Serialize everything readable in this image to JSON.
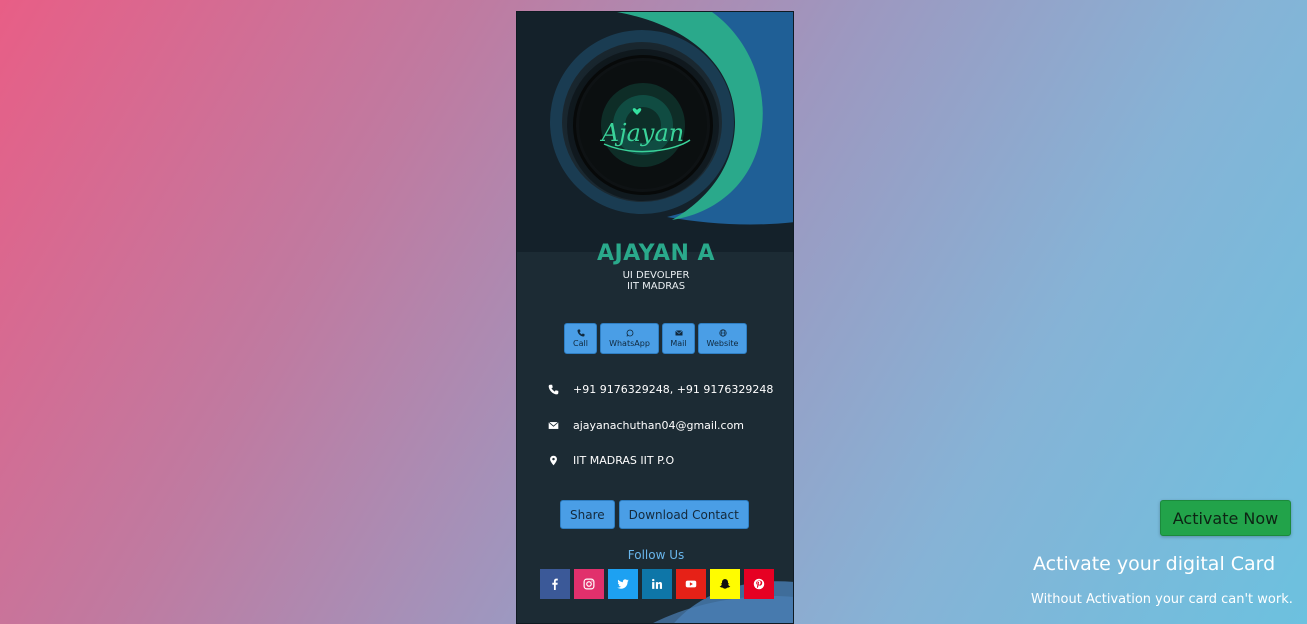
{
  "colors": {
    "accent_green": "#2aa98b",
    "button_blue": "#4a9ee6",
    "activate_green": "#22a34a",
    "follow_blue": "#69b6ec"
  },
  "profile": {
    "logo_text": "Ajayan",
    "name": "AJAYAN A",
    "role": "UI DEVOLPER",
    "org": "IIT MADRAS"
  },
  "quick_actions": [
    {
      "label": "Call",
      "icon": "phone-icon"
    },
    {
      "label": "WhatsApp",
      "icon": "whatsapp-icon"
    },
    {
      "label": "Mail",
      "icon": "envelope-icon"
    },
    {
      "label": "Website",
      "icon": "globe-icon"
    }
  ],
  "contact": {
    "phone": "+91 9176329248, +91 9176329248",
    "email": "ajayanachuthan04@gmail.com",
    "address": "IIT MADRAS IIT P.O"
  },
  "actions": {
    "share": "Share",
    "download": "Download Contact"
  },
  "follow_label": "Follow Us",
  "socials": [
    {
      "name": "facebook",
      "color": "#3b5998"
    },
    {
      "name": "instagram",
      "color": "#e1306c"
    },
    {
      "name": "twitter",
      "color": "#1da1f2"
    },
    {
      "name": "linkedin",
      "color": "#0e76a8"
    },
    {
      "name": "youtube",
      "color": "#e62117"
    },
    {
      "name": "snapchat",
      "color": "#fffc00"
    },
    {
      "name": "pinterest",
      "color": "#e60023"
    }
  ],
  "activation": {
    "button": "Activate Now",
    "title": "Activate your digital Card",
    "subtitle": "Without Activation your card can't work."
  }
}
